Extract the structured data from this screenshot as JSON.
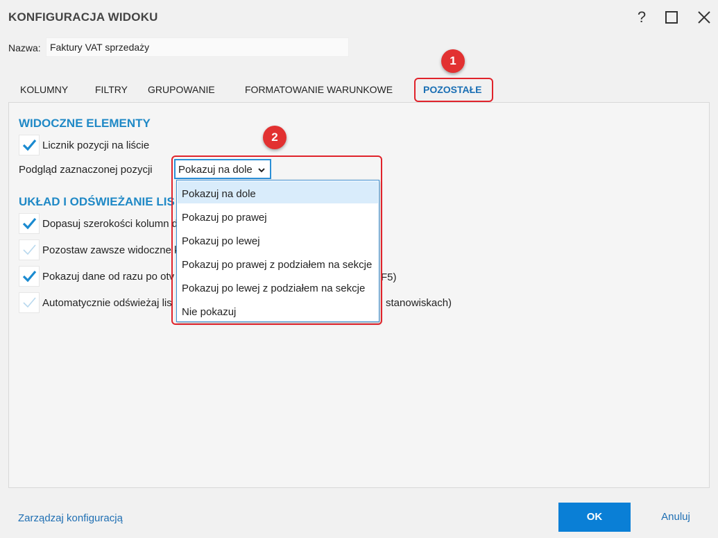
{
  "window": {
    "title": "KONFIGURACJA WIDOKU",
    "help_label": "?"
  },
  "name_field": {
    "label": "Nazwa:",
    "value": "Faktury VAT sprzedaży"
  },
  "tabs": [
    {
      "label": "KOLUMNY"
    },
    {
      "label": "FILTRY"
    },
    {
      "label": "GRUPOWANIE"
    },
    {
      "label": "FORMATOWANIE WARUNKOWE"
    },
    {
      "label": "POZOSTAŁE",
      "active": true
    }
  ],
  "visible_section": {
    "title": "WIDOCZNE ELEMENTY",
    "counter_checkbox": {
      "label": "Licznik pozycji na liście",
      "checked": true
    },
    "preview_label": "Podgląd zaznaczonej pozycji",
    "preview_select": {
      "value": "Pokazuj na dole",
      "options": [
        "Pokazuj na dole",
        "Pokazuj po prawej",
        "Pokazuj po lewej",
        "Pokazuj po prawej z podziałem na sekcje",
        "Pokazuj po lewej z podziałem na sekcje",
        "Nie pokazuj"
      ],
      "selected_index": 0
    }
  },
  "layout_section": {
    "title": "UKŁAD I ODŚWIEŻANIE LIS",
    "options": [
      {
        "label": "Dopasuj szerokości kolumn d",
        "tail": "",
        "checked": true
      },
      {
        "label": "Pozostaw zawsze widoczne k",
        "tail": "",
        "checked": false
      },
      {
        "label": "Pokazuj dane od razu po otv",
        "tail": "F5)",
        "checked": true
      },
      {
        "label": "Automatycznie odświeżaj lis",
        "tail": "stanowiskach)",
        "checked": false
      }
    ]
  },
  "annotations": {
    "badge1": "1",
    "badge2": "2",
    "color": "#e23131"
  },
  "footer": {
    "manage_link": "Zarządzaj konfiguracją",
    "ok_label": "OK",
    "cancel_label": "Anuluj"
  },
  "colors": {
    "accent": "#2089c6",
    "primary_button": "#0a7fd6",
    "link": "#1f6fb3",
    "check": "#1a8ad0",
    "check_off": "#b8d8ee"
  }
}
